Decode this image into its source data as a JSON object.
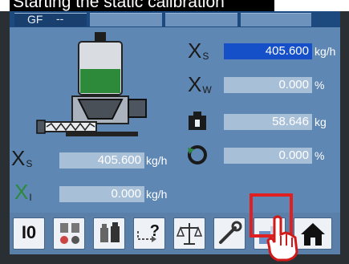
{
  "caption": "Starting the static calibration",
  "tabs": [
    {
      "label": "GF",
      "indicator": "--"
    },
    {
      "label": ""
    },
    {
      "label": ""
    },
    {
      "label": ""
    }
  ],
  "readings": {
    "xs_top": {
      "symbol": "X",
      "sub": "S",
      "value": "405.600",
      "unit": "kg/h",
      "highlighted": true
    },
    "xw": {
      "symbol": "X",
      "sub": "W",
      "value": "0.000",
      "unit": "%"
    },
    "weight": {
      "value": "58.646",
      "unit": "kg"
    },
    "speed": {
      "value": "0.000",
      "unit": "%"
    },
    "xs_left": {
      "symbol": "X",
      "sub": "S",
      "value": "405.600",
      "unit": "kg/h"
    },
    "xi": {
      "symbol": "X",
      "sub": "I",
      "value": "0.000",
      "unit": "kg/h"
    }
  },
  "buttons": [
    {
      "name": "io-button",
      "label": "I0"
    },
    {
      "name": "feeder-settings-button",
      "label": ""
    },
    {
      "name": "bags-button",
      "label": ""
    },
    {
      "name": "help-button",
      "label": "?"
    },
    {
      "name": "calibration-button",
      "label": ""
    },
    {
      "name": "tools-button",
      "label": ""
    },
    {
      "name": "static-calibration-button",
      "label": ""
    },
    {
      "name": "home-button",
      "label": ""
    }
  ],
  "colors": {
    "screen": "#5e87b3",
    "highlight_value": "#1550c8",
    "hotspot": "#e02020"
  }
}
